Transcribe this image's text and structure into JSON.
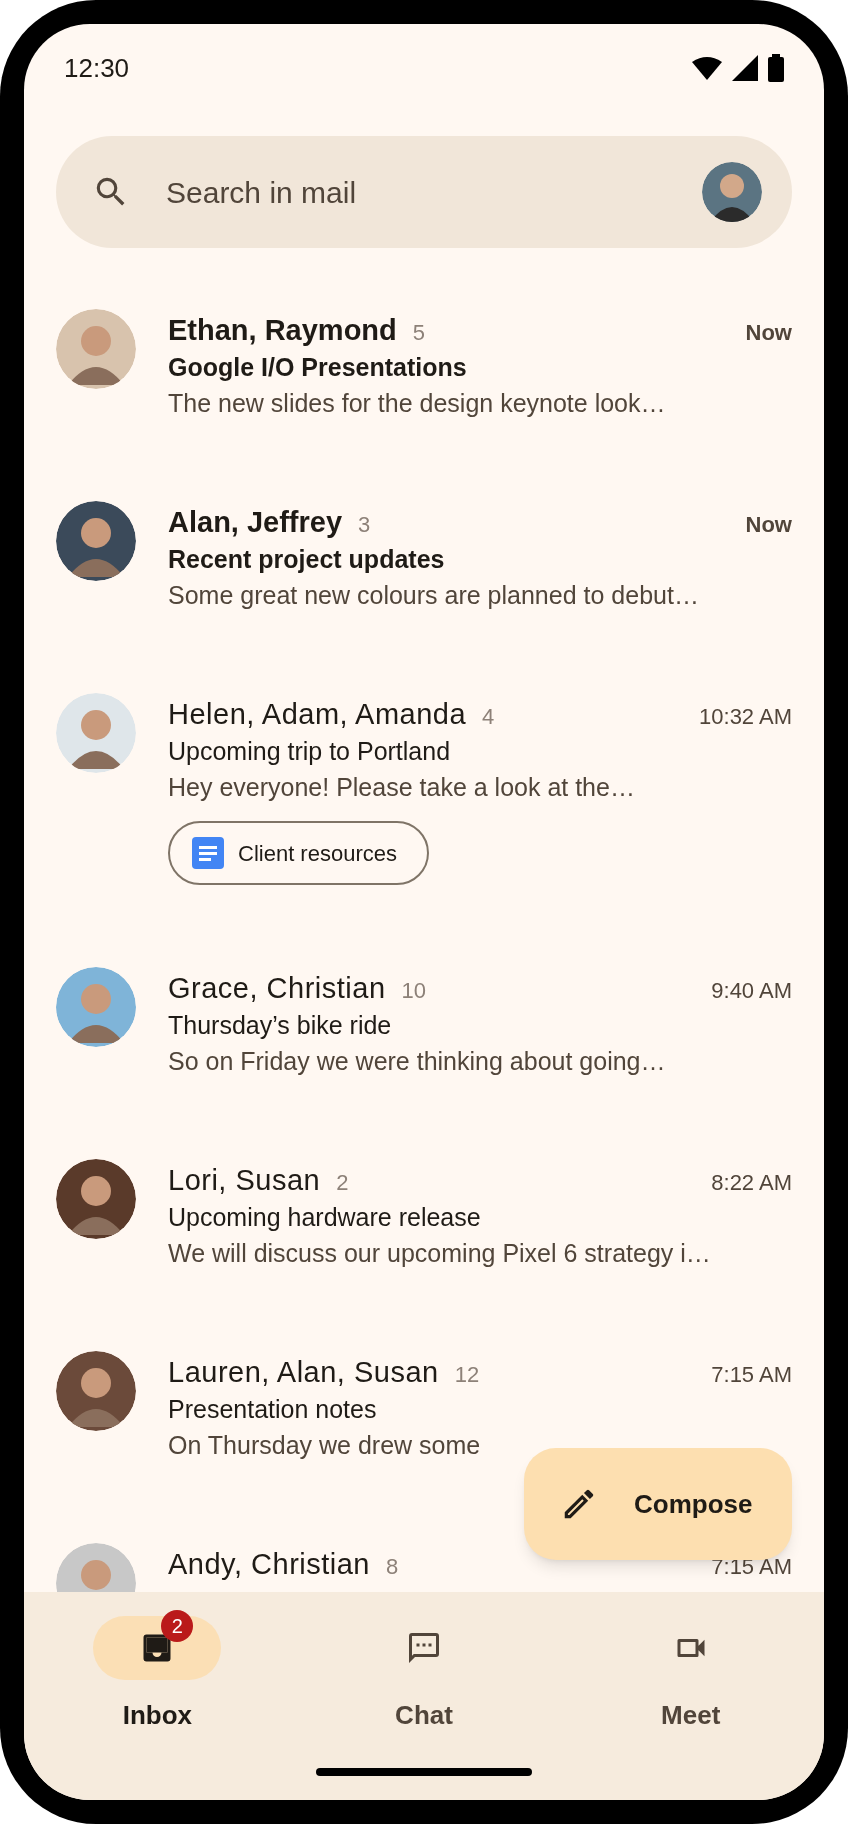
{
  "status_bar": {
    "time": "12:30"
  },
  "search": {
    "placeholder": "Search in mail"
  },
  "emails": [
    {
      "sender": "Ethan, Raymond",
      "count": "5",
      "time": "Now",
      "subject": "Google I/O Presentations",
      "preview": "The new slides for the design keynote look…",
      "unread": true
    },
    {
      "sender": "Alan, Jeffrey",
      "count": "3",
      "time": "Now",
      "subject": "Recent project updates",
      "preview": "Some great new colours are planned to debut…",
      "unread": true
    },
    {
      "sender": "Helen, Adam, Amanda",
      "count": "4",
      "time": "10:32 AM",
      "subject": "Upcoming trip to Portland",
      "preview": "Hey everyone! Please take a look at the…",
      "unread": false,
      "attachment": "Client resources"
    },
    {
      "sender": "Grace, Christian",
      "count": "10",
      "time": "9:40 AM",
      "subject": "Thursday’s bike ride",
      "preview": "So on Friday we were thinking about going…",
      "unread": false
    },
    {
      "sender": "Lori, Susan",
      "count": "2",
      "time": "8:22 AM",
      "subject": "Upcoming hardware release",
      "preview": "We will discuss our upcoming Pixel 6 strategy i…",
      "unread": false
    },
    {
      "sender": "Lauren, Alan, Susan",
      "count": "12",
      "time": "7:15 AM",
      "subject": "Presentation notes",
      "preview": "On Thursday we drew some",
      "unread": false
    },
    {
      "sender": "Andy, Christian",
      "count": "8",
      "time": "7:15 AM",
      "unread": false
    }
  ],
  "compose_button": {
    "label": "Compose"
  },
  "nav": [
    {
      "kind": "inbox",
      "label": "Inbox",
      "selected": true,
      "badge": "2"
    },
    {
      "kind": "chat",
      "label": "Chat",
      "selected": false
    },
    {
      "kind": "meet",
      "label": "Meet",
      "selected": false
    }
  ]
}
